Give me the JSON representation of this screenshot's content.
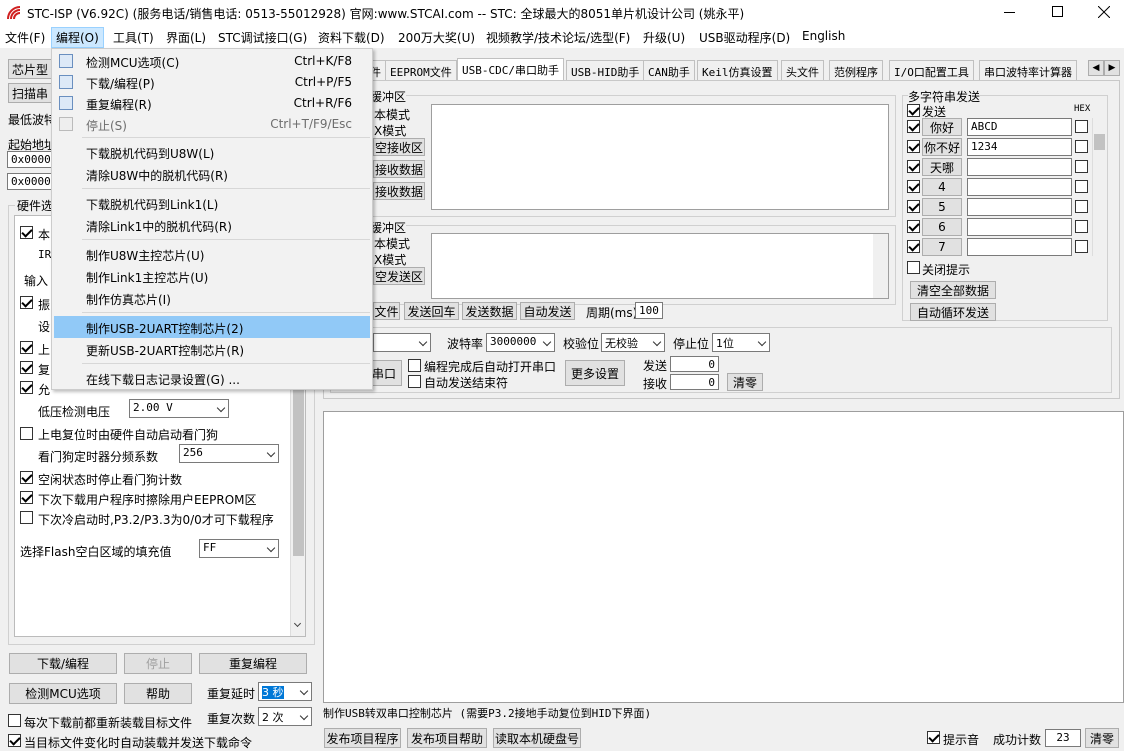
{
  "window": {
    "title": "STC-ISP (V6.92C) (服务电话/销售电话: 0513-55012928) 官网:www.STCAI.com  -- STC: 全球最大的8051单片机设计公司 (姚永平)"
  },
  "menubar": [
    "文件(F)",
    "编程(O)",
    "工具(T)",
    "界面(L)",
    "STC调试接口(G)",
    "资料下载(D)",
    "200万大奖(U)",
    "视频教学/技术论坛/选型(F)",
    "升级(U)",
    "USB驱动程序(D)",
    "English"
  ],
  "dropdown": {
    "items": [
      {
        "label": "检测MCU选项(C)",
        "shortcut": "Ctrl+K/F8",
        "icon": "chip-icon"
      },
      {
        "label": "下载/编程(P)",
        "shortcut": "Ctrl+P/F5",
        "icon": "download-icon"
      },
      {
        "label": "重复编程(R)",
        "shortcut": "Ctrl+R/F6",
        "icon": "repeat-icon"
      },
      {
        "label": "停止(S)",
        "shortcut": "Ctrl+T/F9/Esc",
        "icon": "stop-icon"
      },
      {
        "label": "下载脱机代码到U8W(L)"
      },
      {
        "label": "清除U8W中的脱机代码(R)"
      },
      {
        "label": "下载脱机代码到Link1(L)"
      },
      {
        "label": "清除Link1中的脱机代码(R)"
      },
      {
        "label": "制作U8W主控芯片(U)"
      },
      {
        "label": "制作Link1主控芯片(U)"
      },
      {
        "label": "制作仿真芯片(I)"
      },
      {
        "label": "制作USB-2UART控制芯片(2)"
      },
      {
        "label": "更新USB-2UART控制芯片(R)"
      },
      {
        "label": "在线下载日志记录设置(G) ..."
      }
    ]
  },
  "left": {
    "chip_type": "芯片型",
    "scan": "扫描串",
    "min_baud": "最低波特",
    "start_addr": "起始地址",
    "addr1": "0x0000",
    "addr2": "0x0000",
    "hw_options": "硬件选",
    "opt_ben": "本",
    "opt_ir": "IR",
    "opt_input": "输入",
    "opt_zhen": "振",
    "opt_she": "设",
    "opt_shang": "上",
    "opt_fu": "复",
    "opt_yun": "允",
    "lowvolt_label": "低压检测电压",
    "lowvolt_value": "2.00 V",
    "wdt_label": "上电复位时由硬件自动启动看门狗",
    "wdt_div_label": "看门狗定时器分频系数",
    "wdt_div_value": "256",
    "idle_label": "空闲状态时停止看门狗计数",
    "erase_label": "下次下载用户程序时擦除用户EEPROM区",
    "coldboot_label": "下次冷启动时,P3.2/P3.3为0/0才可下载程序",
    "flash_fill_label": "选择Flash空白区域的填充值",
    "flash_fill_value": "FF",
    "btn_download": "下载/编程",
    "btn_stop": "停止",
    "btn_repeat": "重复编程",
    "btn_detect": "检测MCU选项",
    "btn_help": "帮助",
    "repeat_delay_label": "重复延时",
    "repeat_delay_value": "3 秒",
    "repeat_count_label": "重复次数",
    "repeat_count_value": "2 次",
    "reload_label": "每次下载前都重新装载目标文件",
    "autoload_label": "当目标文件变化时自动装载并发送下载命令"
  },
  "tabs": [
    "件",
    "EEPROM文件",
    "USB-CDC/串口助手",
    "USB-HID助手",
    "CAN助手",
    "Keil仿真设置",
    "头文件",
    "范例程序",
    "I/O口配置工具",
    "串口波特率计算器"
  ],
  "serial": {
    "rx_title": "缓冲区",
    "rx_text_mode": "本模式",
    "rx_hex_mode": "X模式",
    "rx_clear": "空接收区",
    "rx_save": "接收数据",
    "rx_copy": "接收数据",
    "tx_title": "缓冲区",
    "tx_text_mode": "本模式",
    "tx_hex_mode": "X模式",
    "tx_clear": "空发送区",
    "btn_file": "文件",
    "btn_echo": "发送回车",
    "btn_send": "发送数据",
    "btn_auto": "自动发送",
    "period_label": "周期(ms)",
    "period_value": "100",
    "baud_label": "波特率",
    "baud_value": "3000000",
    "parity_label": "校验位",
    "parity_value": "无校验",
    "stop_label": "停止位",
    "stop_value": "1位",
    "open_port": "串口",
    "auto_open_label": "编程完成后自动打开串口",
    "auto_end_label": "自动发送结束符",
    "more_settings": "更多设置",
    "send_label": "发送",
    "send_count": "0",
    "recv_label": "接收",
    "recv_count": "0",
    "clear_btn": "清零"
  },
  "multi": {
    "title": "多字符串发送",
    "send_col": "发送",
    "hex_col": "HEX",
    "rows": [
      {
        "label": "你好",
        "value": "ABCD"
      },
      {
        "label": "你不好",
        "value": "1234"
      },
      {
        "label": "天哪",
        "value": ""
      },
      {
        "label": "4",
        "value": ""
      },
      {
        "label": "5",
        "value": ""
      },
      {
        "label": "6",
        "value": ""
      },
      {
        "label": "7",
        "value": ""
      }
    ],
    "close_tip": "关闭提示",
    "clear_all": "清空全部数据",
    "auto_loop": "自动循环发送"
  },
  "status": {
    "message": "制作USB转双串口控制芯片 (需要P3.2接地手动复位到HID下界面)",
    "publish_project": "发布项目程序",
    "publish_help": "发布项目帮助",
    "read_disk": "读取本机硬盘号",
    "beep_label": "提示音",
    "success_label": "成功计数",
    "success_count": "23",
    "clear": "清零"
  }
}
